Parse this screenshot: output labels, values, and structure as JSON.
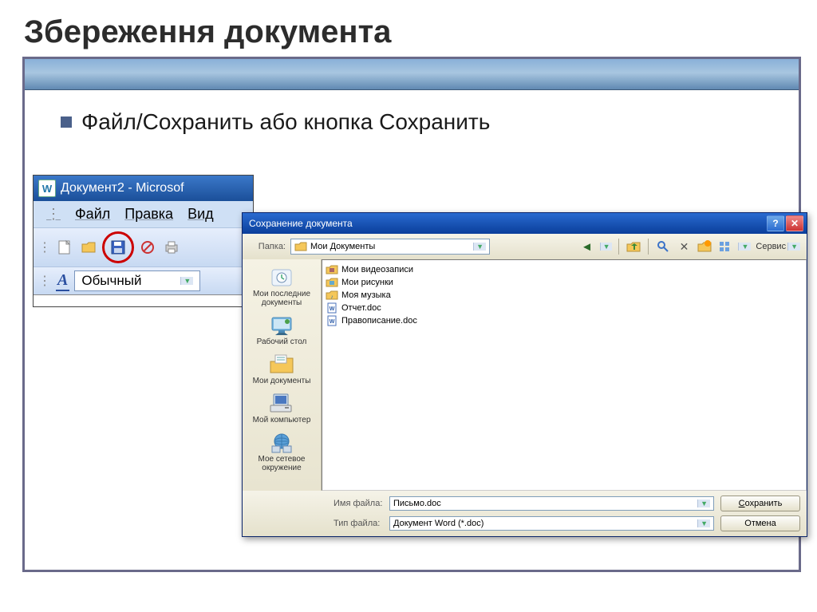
{
  "slide": {
    "title": "Збереження документа",
    "bullet": "Файл/Сохранить  або кнопка Сохранить"
  },
  "word": {
    "title": "Документ2 - Microsof",
    "menu": {
      "file": "Файл",
      "edit": "Правка",
      "view": "Вид"
    },
    "style": "Обычный"
  },
  "dialog": {
    "title": "Сохранение документа",
    "folder_label": "Папка:",
    "folder_value": "Мои Документы",
    "service": "Сервис",
    "places": {
      "recent": "Мои последние документы",
      "desktop": "Рабочий стол",
      "mydocs": "Мои документы",
      "mycomputer": "Мой компьютер",
      "network": "Мое сетевое окружение"
    },
    "files": [
      {
        "name": "Мои видеозаписи",
        "icon": "folder-video"
      },
      {
        "name": "Мои рисунки",
        "icon": "folder-pics"
      },
      {
        "name": "Моя музыка",
        "icon": "folder-music"
      },
      {
        "name": "Отчет.doc",
        "icon": "doc"
      },
      {
        "name": "Правописание.doc",
        "icon": "doc"
      }
    ],
    "filename_label": "Имя файла:",
    "filename_value": "Письмо.doc",
    "filetype_label": "Тип файла:",
    "filetype_value": "Документ Word (*.doc)",
    "save_btn": "Сохранить",
    "cancel_btn": "Отмена"
  }
}
